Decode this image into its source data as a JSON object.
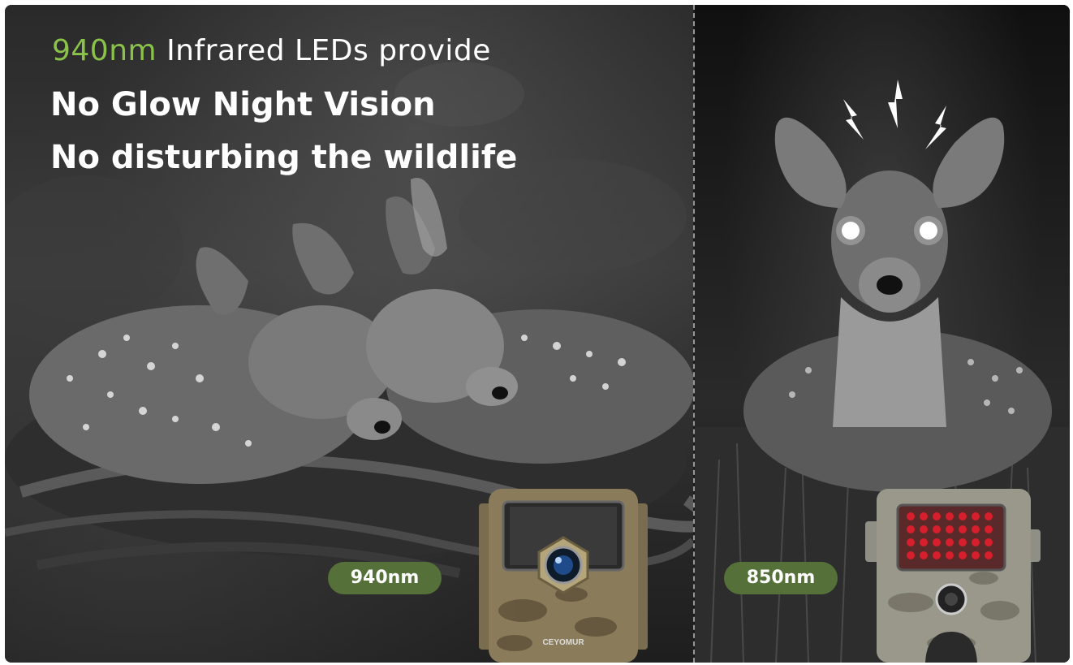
{
  "headline": {
    "wavelength": "940nm",
    "line1_rest": "Infrared LEDs provide",
    "line2": "No Glow Night Vision",
    "line3": "No disturbing the wildlife"
  },
  "badges": {
    "left": "940nm",
    "right": "850nm"
  },
  "camera_brand": "CEYOMUR",
  "colors": {
    "accent_green": "#8bc34a",
    "badge_green": "#56703a",
    "red_led": "#d61f2b"
  }
}
